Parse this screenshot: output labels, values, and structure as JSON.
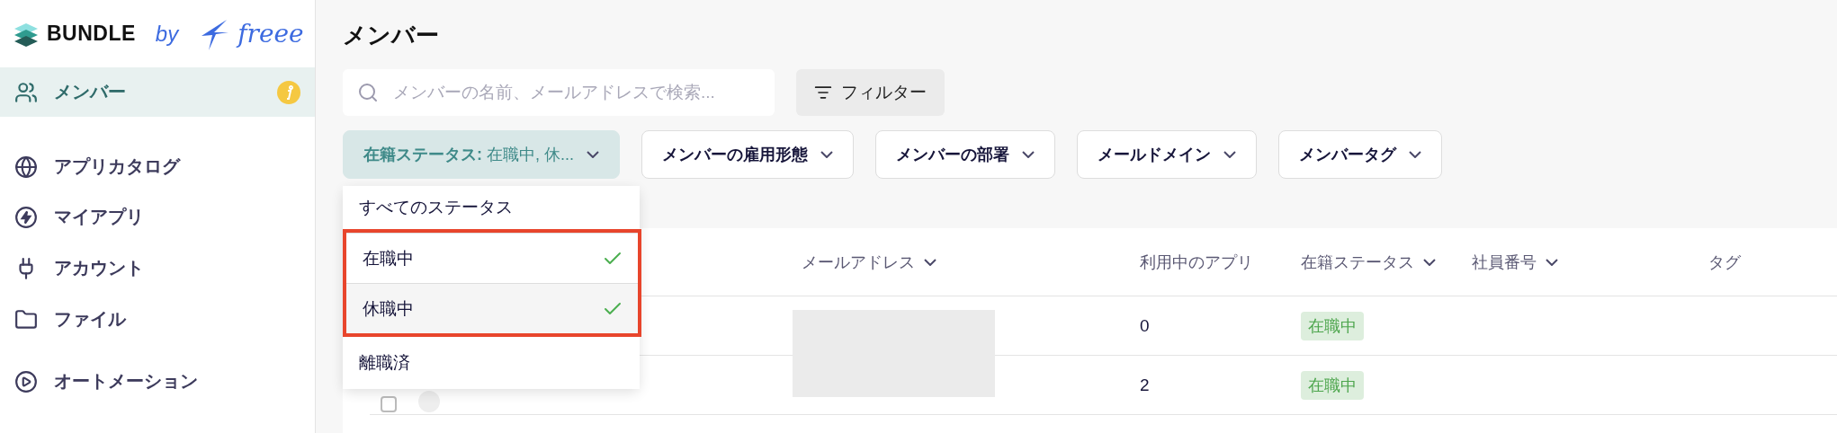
{
  "sidebar": {
    "logo": {
      "brand": "BUNDLE",
      "by": "by",
      "partner": "freee"
    },
    "items": [
      {
        "label": "メンバー",
        "selected": true,
        "alert": true
      },
      {
        "label": "アプリカタログ",
        "selected": false,
        "alert": false
      },
      {
        "label": "マイアプリ",
        "selected": false,
        "alert": false
      },
      {
        "label": "アカウント",
        "selected": false,
        "alert": false
      },
      {
        "label": "ファイル",
        "selected": false,
        "alert": false
      },
      {
        "label": "オートメーション",
        "selected": false,
        "alert": false
      }
    ]
  },
  "main": {
    "title": "メンバー",
    "search": {
      "placeholder": "メンバーの名前、メールアドレスで検索..."
    },
    "filter_button": "フィルター",
    "chips": [
      {
        "label": "在籍ステータス:",
        "value": "在職中, 休...",
        "selected": true
      },
      {
        "label": "メンバーの雇用形態",
        "selected": false
      },
      {
        "label": "メンバーの部署",
        "selected": false
      },
      {
        "label": "メールドメイン",
        "selected": false
      },
      {
        "label": "メンバータグ",
        "selected": false
      }
    ],
    "dropdown": {
      "items": [
        {
          "label": "すべてのステータス",
          "checked": false,
          "hovered": false
        },
        {
          "label": "在職中",
          "checked": true,
          "hovered": false
        },
        {
          "label": "休職中",
          "checked": true,
          "hovered": true
        },
        {
          "label": "離職済",
          "checked": false,
          "hovered": false
        }
      ]
    },
    "table": {
      "columns": [
        {
          "label": "メールアドレス",
          "sortable": true
        },
        {
          "label": "利用中のアプリ",
          "sortable": false
        },
        {
          "label": "在籍ステータス",
          "sortable": true
        },
        {
          "label": "社員番号",
          "sortable": true
        },
        {
          "label": "タグ",
          "sortable": false
        }
      ],
      "rows": [
        {
          "apps": "0",
          "status": "在職中"
        },
        {
          "checked": false,
          "apps": "2",
          "status": "在職中"
        }
      ]
    }
  }
}
